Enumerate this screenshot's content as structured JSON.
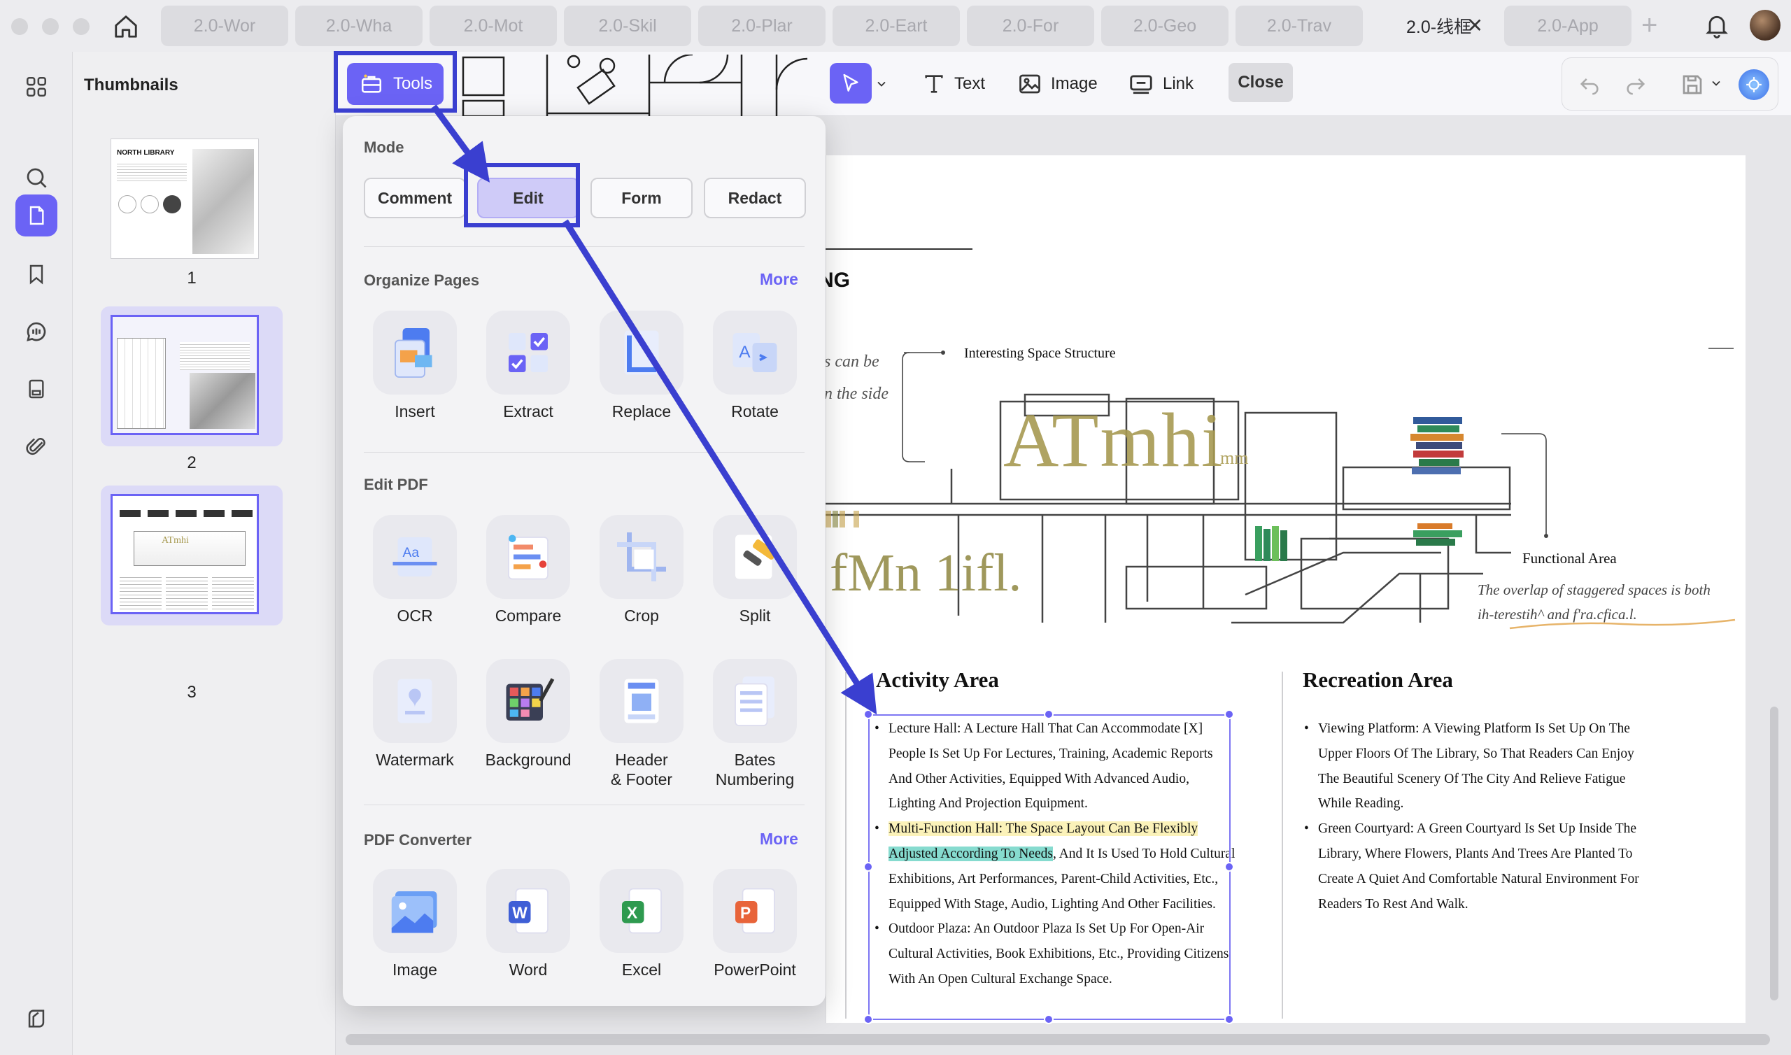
{
  "tabs": [
    {
      "label": "2.0-Wor"
    },
    {
      "label": "2.0-Wha"
    },
    {
      "label": "2.0-Mot"
    },
    {
      "label": "2.0-Skil"
    },
    {
      "label": "2.0-Plar"
    },
    {
      "label": "2.0-Eart"
    },
    {
      "label": "2.0-For"
    },
    {
      "label": "2.0-Geo"
    },
    {
      "label": "2.0-Trav"
    },
    {
      "label": "2.0-线框"
    },
    {
      "label": "2.0-App"
    }
  ],
  "thumbnails": {
    "title": "Thumbnails",
    "thumb1_heading": "NORTH LIBRARY",
    "pages": [
      "1",
      "2",
      "3"
    ]
  },
  "toolbar": {
    "tools_label": "Tools",
    "text_label": "Text",
    "image_label": "Image",
    "link_label": "Link",
    "close_label": "Close"
  },
  "popover": {
    "mode_title": "Mode",
    "modes": [
      "Comment",
      "Edit",
      "Form",
      "Redact"
    ],
    "organize_title": "Organize Pages",
    "organize_more": "More",
    "organize_tools": [
      "Insert",
      "Extract",
      "Replace",
      "Rotate"
    ],
    "edit_title": "Edit PDF",
    "edit_tools": [
      "OCR",
      "Compare",
      "Crop",
      "Split"
    ],
    "edit_tools2": [
      "Watermark",
      "Background",
      "Header\n& Footer",
      "Bates\nNumbering"
    ],
    "converter_title": "PDF Converter",
    "converter_more": "More",
    "converter_tools": [
      "Image",
      "Word",
      "Excel",
      "PowerPoint"
    ]
  },
  "document": {
    "partial_heading": "NG",
    "hand_line1": "s can be",
    "hand_line2": "n  the side",
    "space_label": "Interesting Space Structure",
    "big_text1": "ATmhi",
    "big_text1_suffix": "mm",
    "big_text2": "fMn 1ifl.",
    "functional_label": "Functional Area",
    "overlap_text": "The overlap of staggered spaces is both ih-terestih^ and f'ra.cfica.l.",
    "activity_title": "Activity Area",
    "activity_b1": "Lecture Hall: A Lecture Hall That Can Accommodate [X] People Is Set Up For Lectures, Training, Academic Reports And Other Activities, Equipped With Advanced Audio, Lighting And Projection Equipment.",
    "activity_b2_yellow": "Multi-Function Hall: The Space Layout Can Be Flexibly",
    "activity_b2_teal": "Adjusted According To Needs",
    "activity_b2_rest": ", And It Is Used To Hold Cultural Exhibitions, Art Performances, Parent-Child Activities, Etc., Equipped With Stage, Audio, Lighting And Other Facilities.",
    "activity_b3": "Outdoor Plaza: An Outdoor Plaza Is Set Up For Open-Air Cultural Activities, Book Exhibitions, Etc., Providing Citizens With An Open Cultural Exchange Space.",
    "recreation_title": "Recreation Area",
    "recreation_b1": "Viewing Platform: A Viewing Platform Is Set Up On The Upper Floors Of The Library, So That Readers Can Enjoy The Beautiful Scenery Of The City And Relieve Fatigue While Reading.",
    "recreation_b2": "Green Courtyard: A Green Courtyard Is Set Up Inside The Library, Where Flowers, Plants And Trees Are Planted To Create A Quiet And Comfortable Natural Environment For Readers To Rest And Walk."
  },
  "colors": {
    "accent": "#6b63f5",
    "annotation": "#3a3fd0",
    "highlight_yellow": "#fbf2b9",
    "highlight_teal": "#86dbcf"
  }
}
